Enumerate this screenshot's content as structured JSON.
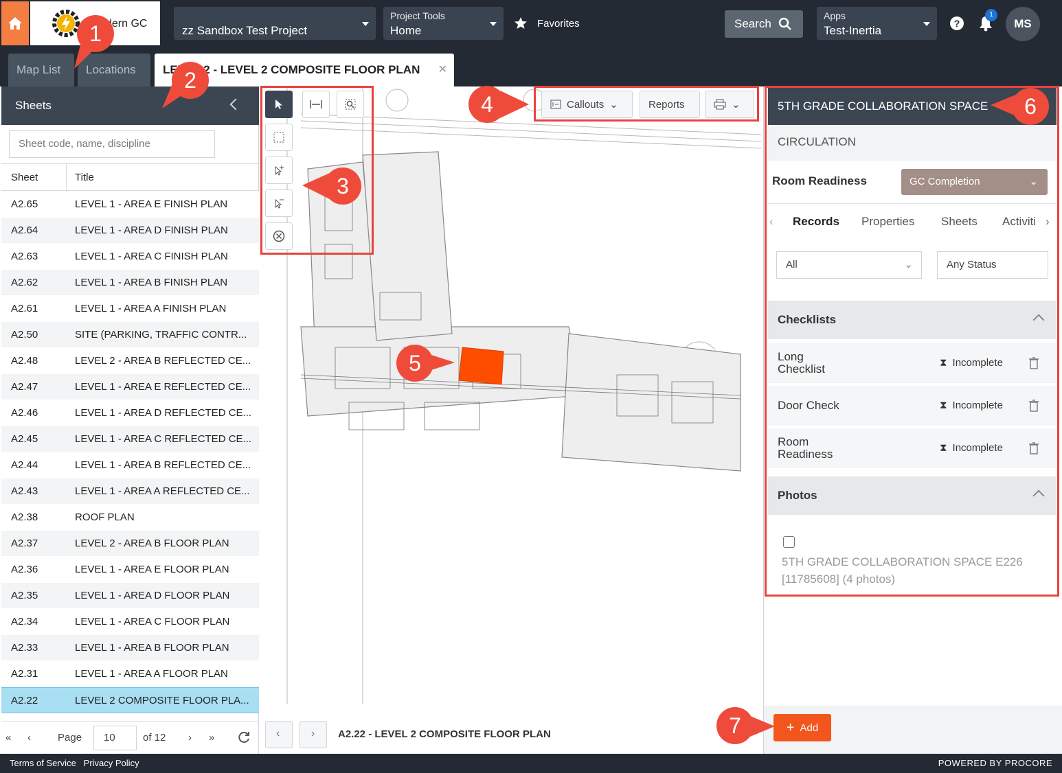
{
  "nav": {
    "logo_text": "dern GC",
    "project_value": "zz Sandbox Test Project",
    "tools_label": "Project Tools",
    "tools_value": "Home",
    "favorites": "Favorites",
    "search": "Search",
    "apps_label": "Apps",
    "apps_value": "Test-Inertia",
    "notif_count": "1",
    "avatar": "MS"
  },
  "tabs": [
    {
      "label": "Map List"
    },
    {
      "label": "Locations"
    },
    {
      "label": "LEVEL 2 - LEVEL 2 COMPOSITE FLOOR PLAN"
    }
  ],
  "sheets": {
    "header": "Sheets",
    "search_placeholder": "Sheet code, name, discipline",
    "col_sheet": "Sheet",
    "col_title": "Title",
    "rows": [
      {
        "code": "A2.65",
        "title": "LEVEL 1 - AREA E FINISH PLAN"
      },
      {
        "code": "A2.64",
        "title": "LEVEL 1 - AREA D FINISH PLAN"
      },
      {
        "code": "A2.63",
        "title": "LEVEL 1 - AREA C FINISH PLAN"
      },
      {
        "code": "A2.62",
        "title": "LEVEL 1 - AREA B FINISH PLAN"
      },
      {
        "code": "A2.61",
        "title": "LEVEL 1 - AREA A FINISH PLAN"
      },
      {
        "code": "A2.50",
        "title": "SITE (PARKING, TRAFFIC CONTR..."
      },
      {
        "code": "A2.48",
        "title": "LEVEL 2 - AREA B REFLECTED CE..."
      },
      {
        "code": "A2.47",
        "title": "LEVEL 1 - AREA E REFLECTED CE..."
      },
      {
        "code": "A2.46",
        "title": "LEVEL 1 - AREA D REFLECTED CE..."
      },
      {
        "code": "A2.45",
        "title": "LEVEL 1 - AREA C REFLECTED CE..."
      },
      {
        "code": "A2.44",
        "title": "LEVEL 1 - AREA B REFLECTED CE..."
      },
      {
        "code": "A2.43",
        "title": "LEVEL 1 - AREA A REFLECTED CE..."
      },
      {
        "code": "A2.38",
        "title": "ROOF PLAN"
      },
      {
        "code": "A2.37",
        "title": "LEVEL 2 - AREA B FLOOR PLAN"
      },
      {
        "code": "A2.36",
        "title": "LEVEL 1 - AREA E FLOOR PLAN"
      },
      {
        "code": "A2.35",
        "title": "LEVEL 1 - AREA D FLOOR PLAN"
      },
      {
        "code": "A2.34",
        "title": "LEVEL 1 - AREA C FLOOR PLAN"
      },
      {
        "code": "A2.33",
        "title": "LEVEL 1 - AREA B FLOOR PLAN"
      },
      {
        "code": "A2.31",
        "title": "LEVEL 1 - AREA A FLOOR PLAN"
      },
      {
        "code": "A2.22",
        "title": "LEVEL 2 COMPOSITE FLOOR PLA...",
        "selected": true
      }
    ],
    "pager": {
      "page_label": "Page",
      "page_value": "10",
      "of_label": "of 12"
    }
  },
  "map": {
    "callouts": "Callouts",
    "reports": "Reports",
    "caption": "A2.22 - LEVEL 2 COMPOSITE FLOOR PLAN",
    "highlight_color": "#ff4d00"
  },
  "detail": {
    "title": "5TH GRADE COLLABORATION SPACE",
    "subtitle": "CIRCULATION",
    "room_readiness_label": "Room Readiness",
    "room_readiness_value": "GC Completion",
    "tabs": [
      "Records",
      "Properties",
      "Sheets",
      "Activiti"
    ],
    "filter_type": "All",
    "filter_status": "Any Status",
    "checklists_header": "Checklists",
    "checklists": [
      {
        "name_1": "Long",
        "name_2": "Checklist",
        "status": "Incomplete"
      },
      {
        "name_1": "Door Check",
        "name_2": "",
        "status": "Incomplete"
      },
      {
        "name_1": "Room",
        "name_2": "Readiness",
        "status": "Incomplete"
      }
    ],
    "photos_header": "Photos",
    "photo_item_1": "5TH GRADE COLLABORATION SPACE E226",
    "photo_item_2": "[11785608] (4 photos)",
    "add": "Add"
  },
  "annotations": [
    "1",
    "2",
    "3",
    "4",
    "5",
    "6",
    "7"
  ],
  "footer": {
    "terms": "Terms of Service",
    "privacy": "Privacy Policy",
    "powered": "POWERED BY PROCORE"
  },
  "colors": {
    "nav_bg": "#232a33",
    "accent_orange": "#f2561d",
    "annotation_red": "#ef4b3a",
    "selected_row": "#a9dff3"
  }
}
